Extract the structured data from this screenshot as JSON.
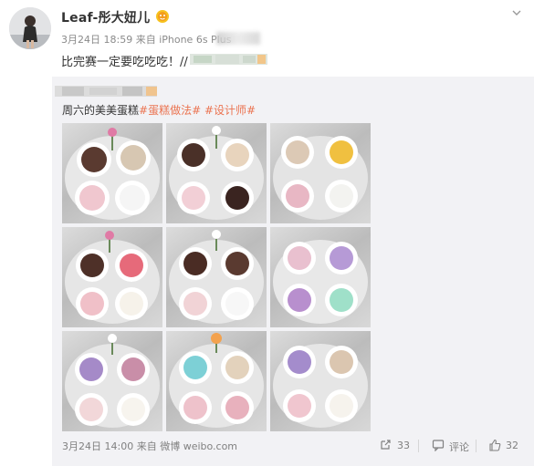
{
  "user": {
    "name": "Leaf-彤大妞儿",
    "avatar_icon": "user-avatar-photo",
    "badge_icon": "vip-level-icon"
  },
  "post": {
    "date": "3月24日 18:59",
    "source": "来自 iPhone 6s Plus",
    "text": "比完赛一定要吃吃吃！//"
  },
  "repost": {
    "content_prefix": "周六的美美蛋糕",
    "tags": [
      "#蛋糕做法#",
      "#设计师#"
    ],
    "image_count": 9,
    "footer": {
      "date": "3月24日 14:00",
      "source": "来自 微博 weibo.com"
    },
    "actions": {
      "share_count": "33",
      "comment_label": "评论",
      "like_count": "32"
    }
  },
  "colors": {
    "accent": "#eb7350",
    "text": "#333333",
    "meta": "#8a8a8a",
    "card_bg": "#f2f2f5"
  }
}
